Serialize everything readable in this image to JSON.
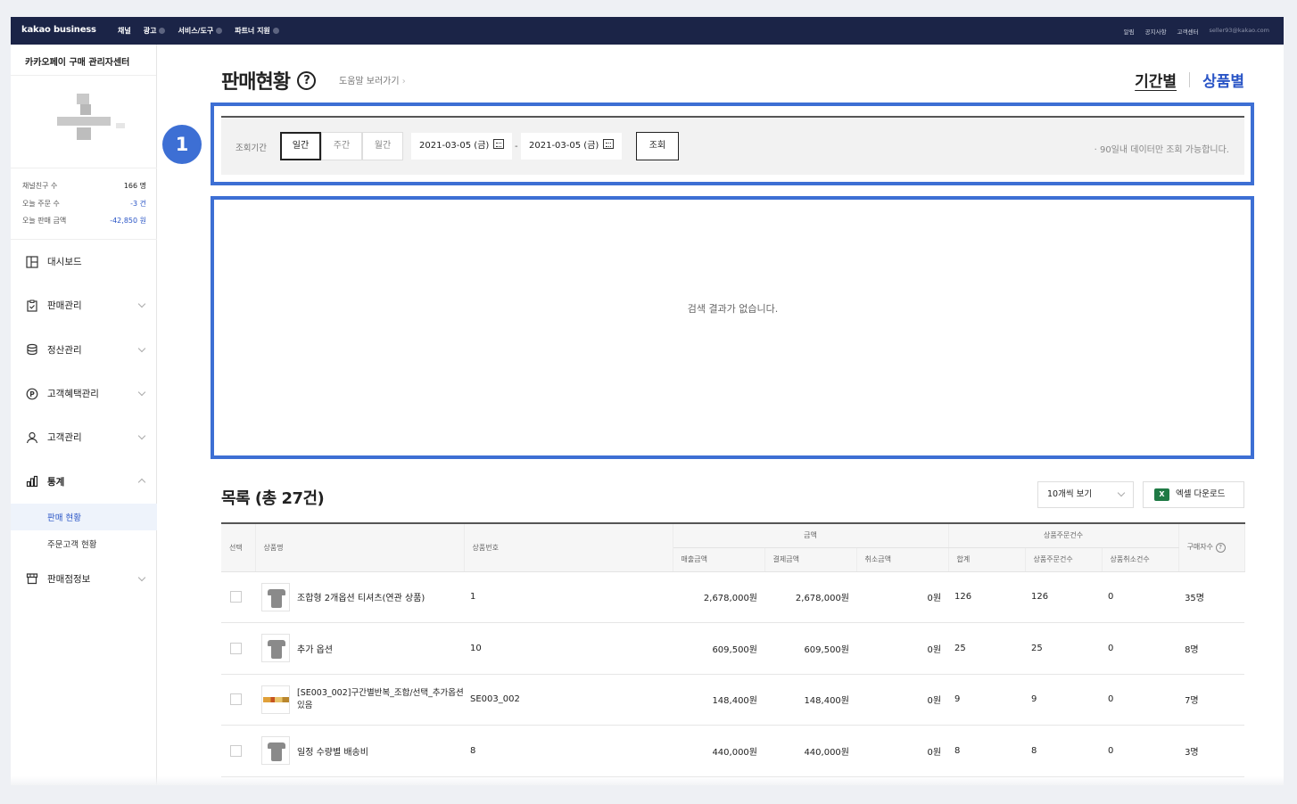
{
  "topbar": {
    "logo": "kakao business",
    "nav": [
      "채널",
      "광고",
      "서비스/도구",
      "파트너 지원"
    ],
    "right": [
      "알림",
      "공지사항",
      "고객센터"
    ],
    "user": "seller93@kakao.com"
  },
  "sidebar": {
    "title": "카카오페이 구매 관리자센터",
    "stats": [
      {
        "label": "채널친구 수",
        "value": "166 명"
      },
      {
        "label": "오늘 주문 수",
        "value": "-3 건"
      },
      {
        "label": "오늘 판매 금액",
        "value": "-42,850 원"
      }
    ],
    "menu": [
      {
        "label": "대시보드",
        "icon": "dashboard-icon"
      },
      {
        "label": "판매관리",
        "icon": "clipboard-icon"
      },
      {
        "label": "정산관리",
        "icon": "database-icon"
      },
      {
        "label": "고객혜택관리",
        "icon": "point-icon"
      },
      {
        "label": "고객관리",
        "icon": "user-icon"
      },
      {
        "label": "통계",
        "icon": "chart-icon"
      },
      {
        "label": "판매점정보",
        "icon": "store-icon"
      }
    ],
    "submenu": [
      "판매 현황",
      "주문고객 현황"
    ]
  },
  "page": {
    "title": "판매현황",
    "help": "도움말 보러가기",
    "tab_period": "기간별",
    "tab_product": "상품별",
    "badge": "1"
  },
  "filter": {
    "label": "조회기간",
    "segments": [
      "일간",
      "주간",
      "월간"
    ],
    "date_from": "2021-03-05 (금)",
    "date_to": "2021-03-05 (금)",
    "dash": "-",
    "search": "조회",
    "note": "· 90일내 데이터만 조회 가능합니다."
  },
  "empty_message": "검색 결과가 없습니다.",
  "list": {
    "title": "목록 (총 27건)",
    "page_size": "10개씩 보기",
    "excel": "엑셀 다운로드",
    "excel_icon_text": "X"
  },
  "table": {
    "h_select": "선택",
    "h_name": "상품명",
    "h_no": "상품번호",
    "h_amount": "금액",
    "h_count": "상품주문건수",
    "h_buyers": "구매자수",
    "h_sales": "매출금액",
    "h_paid": "결제금액",
    "h_cancel": "취소금액",
    "h_total": "합계",
    "h_ordered": "상품주문건수",
    "h_cancelled": "상품취소건수",
    "rows": [
      {
        "name": "조합형 2개옵션 티셔츠(연관 상품)",
        "no": "1",
        "sales": "2,678,000원",
        "paid": "2,678,000원",
        "cancel": "0원",
        "total": "126",
        "ordered": "126",
        "cancelled": "0",
        "buyers": "35명"
      },
      {
        "name": "추가 옵션",
        "no": "10",
        "sales": "609,500원",
        "paid": "609,500원",
        "cancel": "0원",
        "total": "25",
        "ordered": "25",
        "cancelled": "0",
        "buyers": "8명"
      },
      {
        "name": "[SE003_002]구간별반복_조합/선택_추가옵션있음",
        "no": "SE003_002",
        "sales": "148,400원",
        "paid": "148,400원",
        "cancel": "0원",
        "total": "9",
        "ordered": "9",
        "cancelled": "0",
        "buyers": "7명"
      },
      {
        "name": "일정 수량별 배송비",
        "no": "8",
        "sales": "440,000원",
        "paid": "440,000원",
        "cancel": "0원",
        "total": "8",
        "ordered": "8",
        "cancelled": "0",
        "buyers": "3명"
      }
    ]
  },
  "colors": {
    "navy": "#1b2447",
    "accent": "#3d6fd4",
    "link": "#2a55c6"
  }
}
